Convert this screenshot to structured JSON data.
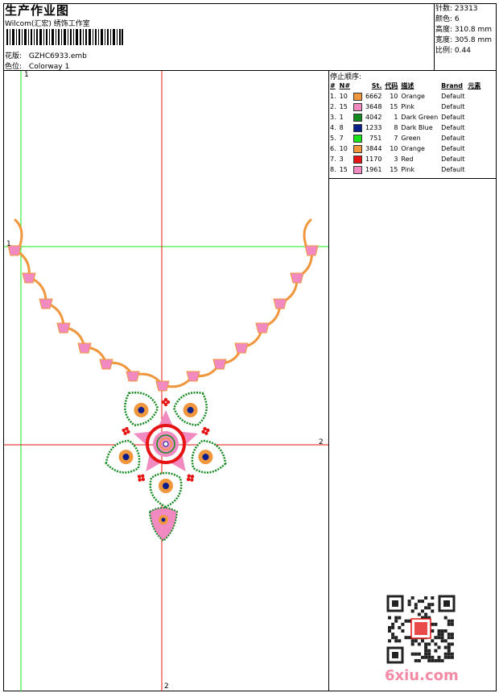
{
  "header": {
    "title": "生产作业图",
    "company": "Wilcom(汇宏) 绣饰工作室",
    "design_label": "花版:",
    "design_value": "GZHC6933.emb",
    "colorway_label": "色位:",
    "colorway_value": "Colorway 1"
  },
  "stats": {
    "stitches": "针数: 23313",
    "colors": "颜色: 6",
    "height": "高度: 310.8 mm",
    "width": "宽度: 305.8 mm",
    "scale": "比例: 0.44"
  },
  "stop_sequence": {
    "title": "停止顺序:",
    "headers": [
      "#",
      "N#",
      "St.",
      "代码",
      "描述",
      "Brand",
      "元素"
    ],
    "rows": [
      {
        "n": "1.",
        "needle": "10",
        "color": "#f0963c",
        "code": "6662",
        "needle2": "10",
        "desc": "Orange",
        "brand": "Default"
      },
      {
        "n": "2.",
        "needle": "15",
        "color": "#f08ac0",
        "code": "3648",
        "needle2": "15",
        "desc": "Pink",
        "brand": "Default"
      },
      {
        "n": "3.",
        "needle": "1",
        "color": "#138a1f",
        "code": "4042",
        "needle2": "1",
        "desc": "Dark Green",
        "brand": "Default"
      },
      {
        "n": "4.",
        "needle": "8",
        "color": "#0a1e8c",
        "code": "1233",
        "needle2": "8",
        "desc": "Dark Blue",
        "brand": "Default"
      },
      {
        "n": "5.",
        "needle": "7",
        "color": "#19e619",
        "code": "751",
        "needle2": "7",
        "desc": "Green",
        "brand": "Default"
      },
      {
        "n": "6.",
        "needle": "10",
        "color": "#f0963c",
        "code": "3844",
        "needle2": "10",
        "desc": "Orange",
        "brand": "Default"
      },
      {
        "n": "7.",
        "needle": "3",
        "color": "#e61414",
        "code": "1170",
        "needle2": "3",
        "desc": "Red",
        "brand": "Default"
      },
      {
        "n": "8.",
        "needle": "15",
        "color": "#f08ac0",
        "code": "1961",
        "needle2": "15",
        "desc": "Pink",
        "brand": "Default"
      }
    ]
  },
  "axes": {
    "v1": "1",
    "h1": "1",
    "h2": "2",
    "v2": "2"
  },
  "colors": {
    "guide_green": "#19e619",
    "guide_red": "#e61414",
    "orange": "#f0963c",
    "pink": "#f08ac0",
    "dark_green": "#138a1f"
  },
  "watermark": {
    "site": "6xiu.com",
    "qr_icon": "qr-code-icon"
  }
}
